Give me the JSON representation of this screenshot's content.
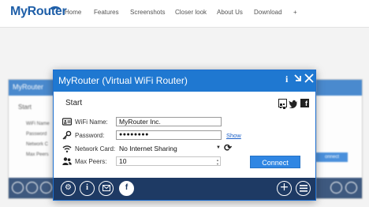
{
  "site": {
    "logo": "MyRouter",
    "nav": [
      "Home",
      "Features",
      "Screenshots",
      "Closer look",
      "About Us",
      "Download",
      "+"
    ]
  },
  "ghost_left": {
    "title": "MyRouter",
    "section": "Start",
    "labels": [
      "WiFi Name",
      "Password",
      "Network C",
      "Max Peers"
    ]
  },
  "ghost_right": {
    "button": "onnect"
  },
  "app": {
    "title": "MyRouter (Virtual WiFi Router)",
    "panel_title": "Start",
    "wifi_name_label": "WiFi Name:",
    "wifi_name_value": "MyRouter Inc.",
    "password_label": "Password:",
    "password_value": "●●●●●●●●",
    "show_link": "Show",
    "network_card_label": "Network Card:",
    "network_card_value": "No Internet Sharing",
    "max_peers_label": "Max Peers:",
    "max_peers_value": "10",
    "connect_label": "Connect"
  },
  "colors": {
    "accent": "#1f78d1",
    "bottom_bar": "#1e3a64",
    "connect": "#2f86e3"
  },
  "icons": {
    "titlebar": [
      "info-icon",
      "minimize-icon",
      "close-icon"
    ],
    "social": [
      "qr-share-icon",
      "twitter-icon",
      "facebook-icon"
    ],
    "bottom_left": [
      "settings-icon",
      "info-icon",
      "email-icon",
      "facebook-icon"
    ],
    "bottom_right": [
      "add-icon",
      "list-icon"
    ]
  }
}
